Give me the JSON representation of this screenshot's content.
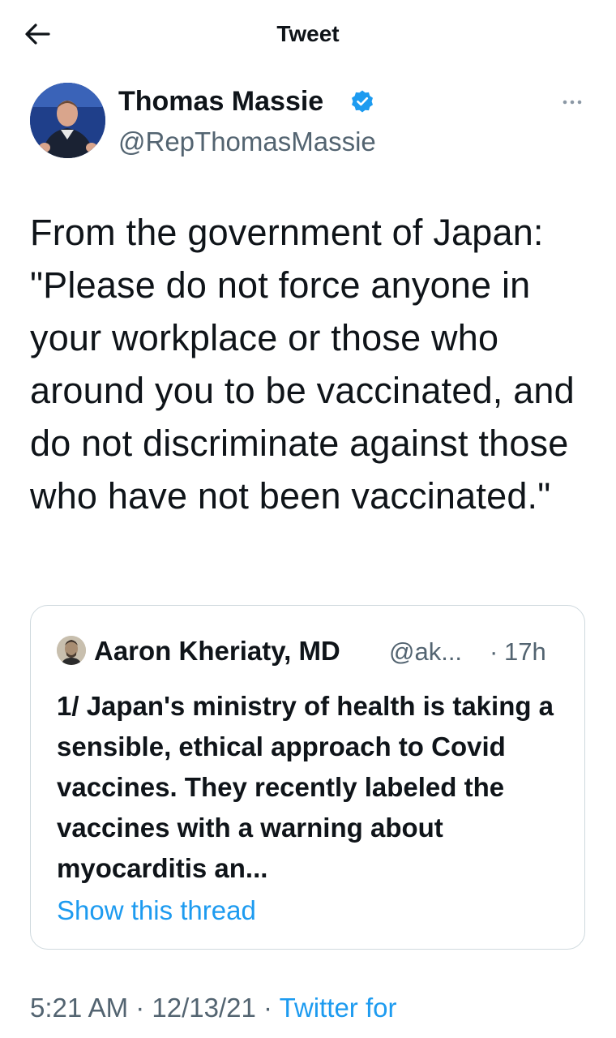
{
  "header": {
    "title": "Tweet",
    "back_icon": "arrow-left-icon"
  },
  "author": {
    "name": "Thomas Massie",
    "handle": "@RepThomasMassie",
    "verified": true,
    "more_icon": "more-horizontal-icon"
  },
  "tweet": {
    "text": "From the government of Japan: \"Please do not force anyone in your workplace or those who around you to be vaccinated, and do not discriminate against those who have not been vaccinated.\""
  },
  "quote": {
    "name": "Aaron Kheriaty, MD",
    "handle": "@ak...",
    "separator": "·",
    "time": "17h",
    "text": "1/ Japan's ministry of health is taking a sensible, ethical approach to Covid vaccines. They recently labeled the vaccines with a warning about myocarditis an...",
    "show_thread": "Show this thread"
  },
  "meta": {
    "time": "5:21 AM",
    "sep1": " · ",
    "date": "12/13/21",
    "sep2": " · ",
    "source": "Twitter for"
  },
  "colors": {
    "text": "#0f1419",
    "secondary": "#536471",
    "link": "#1d9bf0",
    "border": "#cfd9de"
  }
}
